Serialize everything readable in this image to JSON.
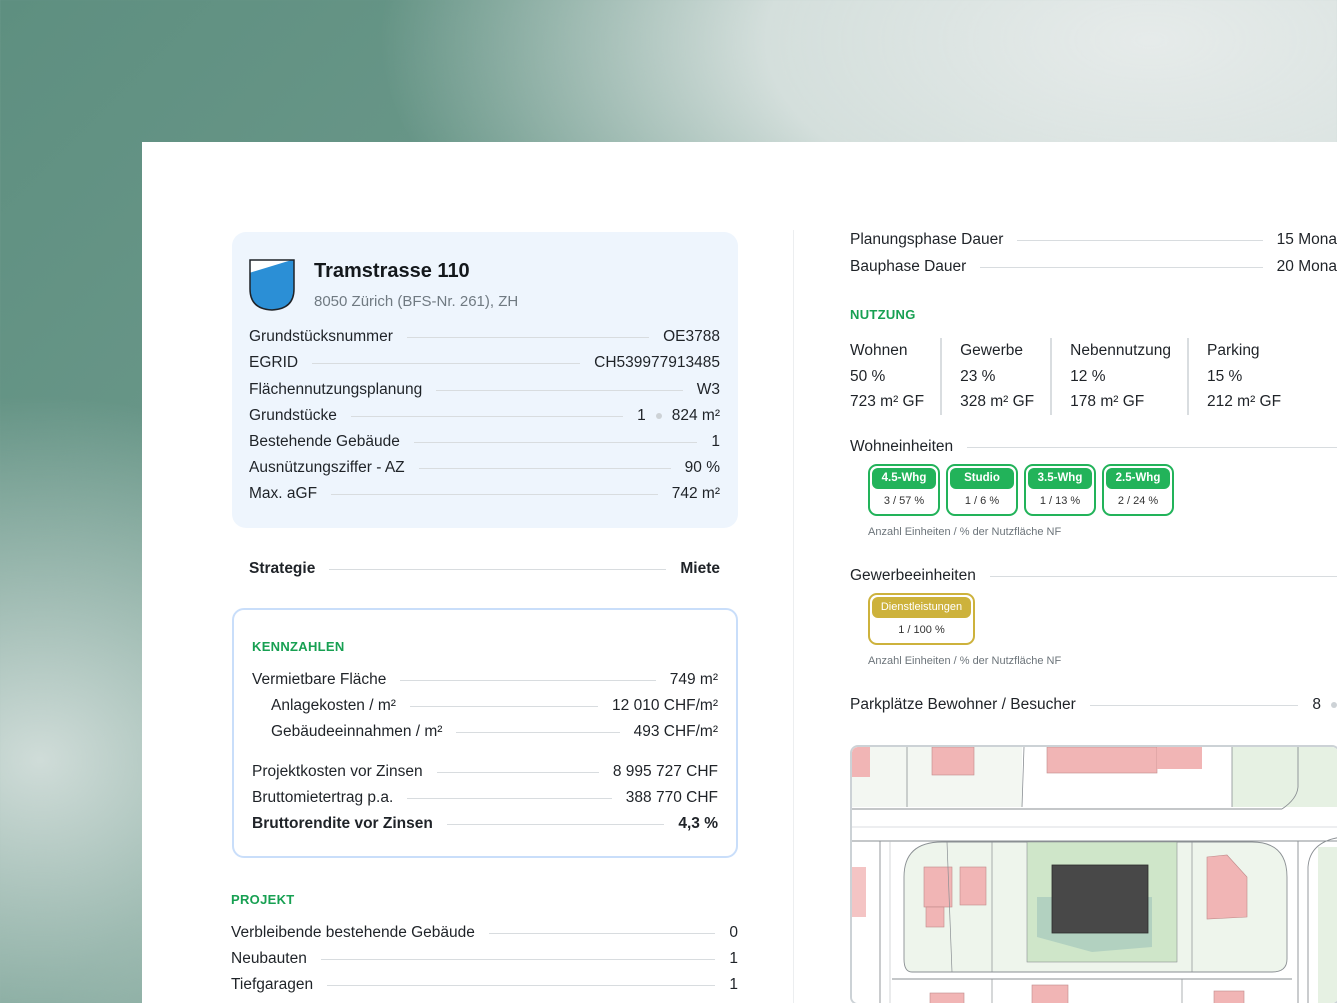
{
  "property": {
    "title": "Tramstrasse 110",
    "subtitle": "8050 Zürich (BFS-Nr. 261), ZH",
    "rows": [
      {
        "label": "Grundstücksnummer",
        "value": "OE3788"
      },
      {
        "label": "EGRID",
        "value": "CH539977913485"
      },
      {
        "label": "Flächennutzungsplanung",
        "value": "W3"
      },
      {
        "label": "Grundstücke",
        "value_count": "1",
        "value": "824 m²"
      },
      {
        "label": "Bestehende Gebäude",
        "value": "1"
      },
      {
        "label": "Ausnützungsziffer - AZ",
        "value": "90 %"
      },
      {
        "label": "Max. aGF",
        "value": "742 m²"
      }
    ]
  },
  "strategy": {
    "label": "Strategie",
    "value": "Miete"
  },
  "kennzahlen": {
    "heading": "KENNZAHLEN",
    "rows": [
      {
        "label": "Vermietbare Fläche",
        "value": "749 m²"
      },
      {
        "label": "Anlagekosten / m²",
        "value": "12 010 CHF/m²"
      },
      {
        "label": "Gebäudeeinnahmen / m²",
        "value": "493 CHF/m²"
      },
      {
        "label": "Projektkosten vor Zinsen",
        "value": "8 995 727 CHF"
      },
      {
        "label": "Bruttomietertrag p.a.",
        "value": "388 770 CHF"
      },
      {
        "label": "Bruttorendite vor Zinsen",
        "value": "4,3 %"
      }
    ]
  },
  "projekt": {
    "heading": "PROJEKT",
    "rows": [
      {
        "label": "Verbleibende bestehende Gebäude",
        "value": "0"
      },
      {
        "label": "Neubauten",
        "value": "1"
      },
      {
        "label": "Tiefgaragen",
        "value": "1"
      }
    ]
  },
  "phases": [
    {
      "label": "Planungsphase Dauer",
      "value": "15 Mona"
    },
    {
      "label": "Bauphase Dauer",
      "value": "20 Mona"
    }
  ],
  "nutzung": {
    "heading": "NUTZUNG",
    "columns": [
      {
        "name": "Wohnen",
        "percent": "50 %",
        "area": "723 m² GF"
      },
      {
        "name": "Gewerbe",
        "percent": "23 %",
        "area": "328 m² GF"
      },
      {
        "name": "Nebennutzung",
        "percent": "12 %",
        "area": "178 m² GF"
      },
      {
        "name": "Parking",
        "percent": "15 %",
        "area": "212 m² GF"
      }
    ]
  },
  "wohneinheiten": {
    "label": "Wohneinheiten",
    "chips": [
      {
        "type": "4.5-Whg",
        "value": "3 / 57 %"
      },
      {
        "type": "Studio",
        "value": "1 / 6 %"
      },
      {
        "type": "3.5-Whg",
        "value": "1 / 13 %"
      },
      {
        "type": "2.5-Whg",
        "value": "2 / 24 %"
      }
    ],
    "hint": "Anzahl Einheiten / % der Nutzfläche NF"
  },
  "gewerbeeinheiten": {
    "label": "Gewerbeeinheiten",
    "chips": [
      {
        "type": "Dienstleistungen",
        "value": "1 / 100 %"
      }
    ],
    "hint": "Anzahl Einheiten / % der Nutzfläche NF"
  },
  "parking": {
    "label": "Parkplätze Bewohner / Besucher",
    "value": "8"
  },
  "colors": {
    "accent_green": "#22b35a",
    "gold": "#cdb23c",
    "card_blue": "#eef5fd",
    "zurich_blue": "#2b8fd6"
  }
}
